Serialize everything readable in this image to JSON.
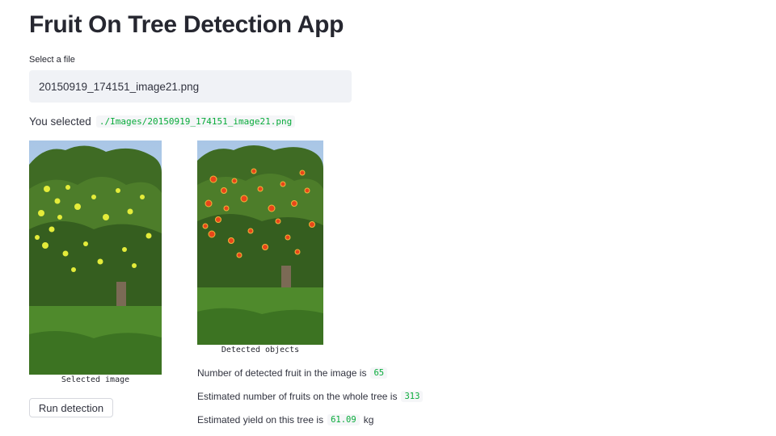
{
  "app": {
    "title": "Fruit On Tree Detection App"
  },
  "file_select": {
    "label": "Select a file",
    "value": "20150919_174151_image21.png"
  },
  "selection": {
    "prefix": "You selected",
    "path": "./Images/20150919_174151_image21.png"
  },
  "images": {
    "selected_caption": "Selected image",
    "detected_caption": "Detected objects"
  },
  "actions": {
    "run_label": "Run detection"
  },
  "results": {
    "detected_label": "Number of detected fruit in the image is",
    "detected_value": "65",
    "tree_label": "Estimated number of fruits on the whole tree is",
    "tree_value": "313",
    "yield_label": "Estimated yield on this tree is",
    "yield_value": "61.09",
    "yield_unit": "kg"
  },
  "colors": {
    "code_text": "#09ab3b",
    "select_bg": "#f0f2f6",
    "fruit_yellow": "#e4ec3a",
    "fruit_red": "#e8461a"
  }
}
